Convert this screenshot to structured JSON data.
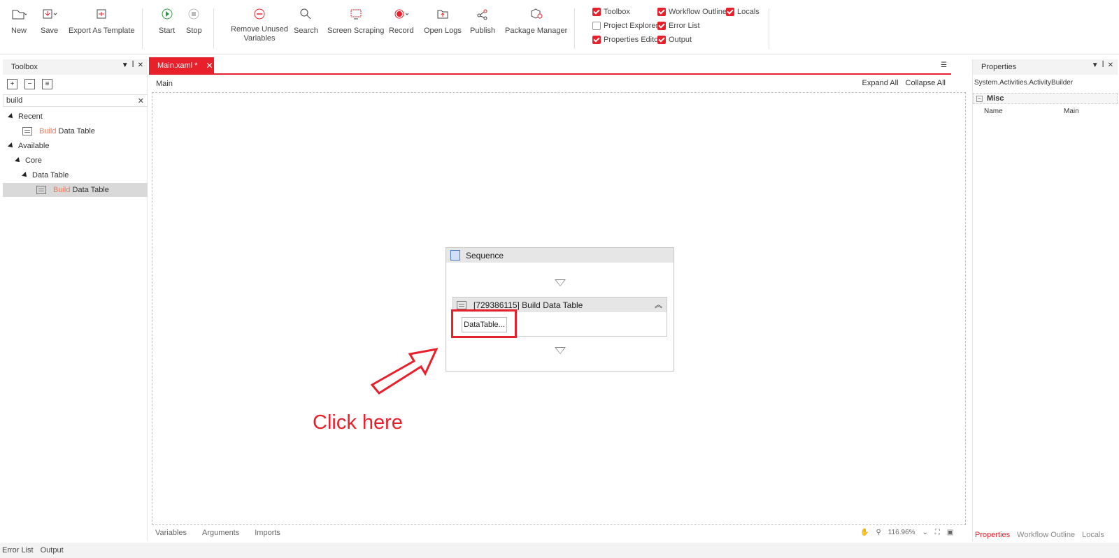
{
  "ribbon": {
    "buttons": {
      "new": "New",
      "save": "Save",
      "export_template": "Export As Template",
      "start": "Start",
      "stop": "Stop",
      "remove_unused_1": "Remove Unused",
      "remove_unused_2": "Variables",
      "search": "Search",
      "screen_scraping": "Screen Scraping",
      "record": "Record",
      "open_logs": "Open Logs",
      "publish": "Publish",
      "package_manager": "Package Manager"
    },
    "checkboxes": {
      "toolbox": {
        "label": "Toolbox",
        "checked": true
      },
      "project_explorer": {
        "label": "Project Explorer",
        "checked": false
      },
      "properties_editor": {
        "label": "Properties Editor",
        "checked": true
      },
      "workflow_outline": {
        "label": "Workflow Outline",
        "checked": true
      },
      "error_list": {
        "label": "Error List",
        "checked": true
      },
      "output": {
        "label": "Output",
        "checked": true
      },
      "locals": {
        "label": "Locals",
        "checked": true
      }
    }
  },
  "toolbox": {
    "title": "Toolbox",
    "search_value": "build",
    "tree": {
      "recent": "Recent",
      "recent_item_hl": "Build",
      "recent_item_rest": " Data Table",
      "available": "Available",
      "core": "Core",
      "data_table": "Data Table",
      "item_hl": "Build",
      "item_rest": " Data Table"
    }
  },
  "tab": {
    "label": "Main.xaml *"
  },
  "breadcrumb": {
    "main": "Main",
    "expand_all": "Expand All",
    "collapse_all": "Collapse All"
  },
  "designer": {
    "sequence_title": "Sequence",
    "activity_title": "[729386115] Build Data Table",
    "datatable_button": "DataTable...",
    "annotation": "Click here",
    "bottom_tabs": [
      "Variables",
      "Arguments",
      "Imports"
    ],
    "zoom": "116.96%"
  },
  "properties": {
    "title": "Properties",
    "type": "System.Activities.ActivityBuilder",
    "category": "Misc",
    "row_name": "Name",
    "row_value": "Main",
    "bottom_tabs": [
      "Properties",
      "Workflow Outline",
      "Locals"
    ]
  },
  "statusbar": {
    "error_list": "Error List",
    "output": "Output"
  },
  "colors": {
    "accent": "#e8202b",
    "highlight": "#f07a5c"
  }
}
